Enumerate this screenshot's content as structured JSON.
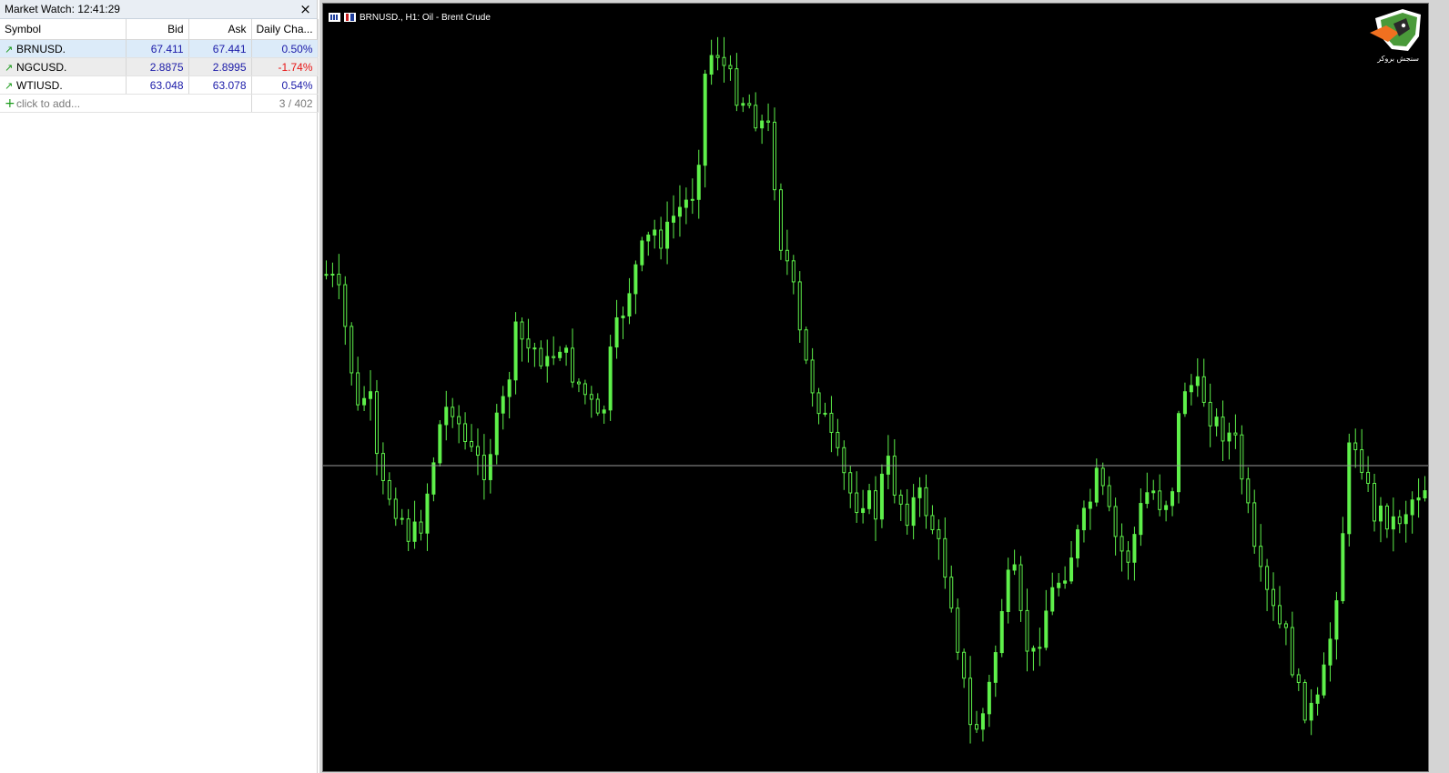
{
  "market_watch": {
    "title": "Market Watch: 12:41:29",
    "close_icon": "×",
    "columns": {
      "symbol": "Symbol",
      "bid": "Bid",
      "ask": "Ask",
      "change": "Daily Cha..."
    },
    "rows": [
      {
        "arrow": "up-arrow-icon",
        "symbol": "BRNUSD.",
        "bid": "67.411",
        "ask": "67.441",
        "change": "0.50%"
      },
      {
        "arrow": "up-arrow-icon",
        "symbol": "NGCUSD.",
        "bid": "2.8875",
        "ask": "2.8995",
        "change": "-1.74%"
      },
      {
        "arrow": "up-arrow-icon",
        "symbol": "WTIUSD.",
        "bid": "63.048",
        "ask": "63.078",
        "change": "0.54%"
      }
    ],
    "add_label": "click to add...",
    "count": "3 / 402"
  },
  "chart": {
    "title": "BRNUSD., H1:  Oil - Brent Crude",
    "logo_text": "سنجش بروکر",
    "colors": {
      "background": "#000000",
      "candle": "#5ef04a",
      "price_line": "#9a9a9a"
    },
    "bars": 175,
    "seed_path": [
      298,
      310,
      370,
      450,
      420,
      530,
      540,
      560,
      590,
      570,
      510,
      450,
      440,
      480,
      500,
      510,
      470,
      430,
      360,
      380,
      380,
      400,
      370,
      400,
      420,
      440,
      470,
      380,
      340,
      300,
      270,
      250,
      260,
      230,
      220,
      200,
      60,
      50,
      80,
      100,
      110,
      130,
      140,
      260,
      300,
      380,
      420,
      450,
      490,
      520,
      550,
      540,
      560,
      500,
      540,
      560,
      540,
      560,
      600,
      640,
      720,
      800,
      790,
      740,
      660,
      620,
      700,
      720,
      670,
      640,
      620,
      590,
      560,
      520,
      560,
      600,
      610,
      560,
      530,
      550,
      540,
      420,
      420,
      430,
      460,
      470,
      480,
      540,
      620,
      650,
      680,
      700,
      760,
      780,
      770,
      700,
      610,
      470,
      500,
      560,
      560,
      570,
      560,
      540,
      530
    ]
  }
}
